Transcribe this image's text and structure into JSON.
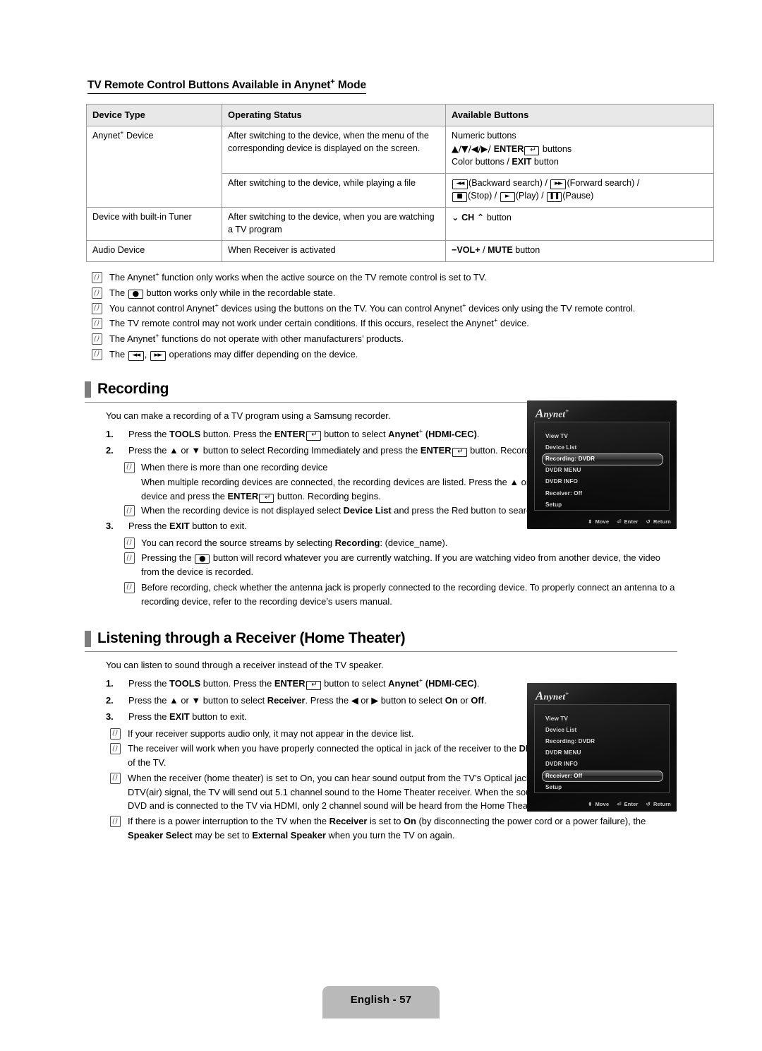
{
  "document": {
    "subtitle_pre": "TV Remote Control Buttons Available in Anynet",
    "subtitle_post": " Mode",
    "sup_plus": "+"
  },
  "table": {
    "headers": [
      "Device Type",
      "Operating Status",
      "Available Buttons"
    ],
    "rows": [
      {
        "device_type": "Anynet+ Device",
        "device_type_pre": "Anynet",
        "device_type_post": " Device",
        "status": "After switching to the device, when the menu of the corresponding device is displayed on the screen.",
        "buttons_line1": "Numeric buttons",
        "buttons_line2_arrows": "▲/▼/◀/▶/ ",
        "buttons_line2_enter": "ENTER",
        "buttons_line2_tail": " buttons",
        "buttons_line3_pre": "Color buttons / ",
        "buttons_line3_exit": "EXIT",
        "buttons_line3_post": " button"
      },
      {
        "status": "After switching to the device, while playing a file",
        "buttons_backward": "(Backward search) / ",
        "buttons_forward": "(Forward search) / ",
        "buttons_stop": "(Stop) / ",
        "buttons_play": "(Play) / ",
        "buttons_pause": "(Pause)"
      },
      {
        "device_type": "Device with built-in Tuner",
        "status": "After switching to the device, when you are watching a TV program",
        "buttons_ch": "CH",
        "buttons_ch_tail": " button"
      },
      {
        "device_type": "Audio Device",
        "status": "When Receiver is activated",
        "buttons_vol": "VOL",
        "buttons_mute": "MUTE",
        "buttons_vol_tail": " button"
      }
    ]
  },
  "top_notes": [
    {
      "parts": [
        {
          "t": "The Anynet"
        },
        {
          "t": "+",
          "sup": true
        },
        {
          "t": " function only works when the active source on the TV remote control is set to TV."
        }
      ]
    },
    {
      "parts": [
        {
          "t": "The "
        },
        {
          "key": "rec"
        },
        {
          "t": " button works only while in the recordable state."
        }
      ]
    },
    {
      "parts": [
        {
          "t": "You cannot control Anynet"
        },
        {
          "t": "+",
          "sup": true
        },
        {
          "t": " devices using the buttons on the TV. You can control Anynet"
        },
        {
          "t": "+",
          "sup": true
        },
        {
          "t": " devices only using the TV remote control."
        }
      ]
    },
    {
      "parts": [
        {
          "t": "The TV remote control may not work under certain conditions. If this occurs, reselect the Anynet"
        },
        {
          "t": "+",
          "sup": true
        },
        {
          "t": " device."
        }
      ]
    },
    {
      "parts": [
        {
          "t": "The Anynet"
        },
        {
          "t": "+",
          "sup": true
        },
        {
          "t": " functions do not operate with other manufacturers’ products."
        }
      ]
    },
    {
      "parts": [
        {
          "t": "The "
        },
        {
          "key": "rew"
        },
        {
          "t": ", "
        },
        {
          "key": "ffw"
        },
        {
          "t": " operations may differ depending on the device."
        }
      ]
    }
  ],
  "recording": {
    "heading": "Recording",
    "intro": "You can make a recording of a TV program using a Samsung recorder.",
    "steps": [
      {
        "num": "1.",
        "parts": [
          {
            "t": "Press the "
          },
          {
            "t": "TOOLS",
            "b": true
          },
          {
            "t": " button. Press the "
          },
          {
            "t": "ENTER",
            "b": true
          },
          {
            "key": "enter"
          },
          {
            "t": " button to select "
          },
          {
            "t": "Anynet",
            "b": true
          },
          {
            "t": "+",
            "sup": true,
            "b": true
          },
          {
            "t": " (HDMI-CEC)",
            "b": true
          },
          {
            "t": "."
          }
        ]
      },
      {
        "num": "2.",
        "parts": [
          {
            "t": "Press the ▲ or ▼ button to select Recording Immediately and press the "
          },
          {
            "t": "ENTER",
            "b": true
          },
          {
            "key": "enter"
          },
          {
            "t": " button. Recording begins."
          }
        ]
      },
      {
        "num": "3.",
        "parts": [
          {
            "t": "Press the "
          },
          {
            "t": "EXIT",
            "b": true
          },
          {
            "t": " button to exit."
          }
        ]
      }
    ],
    "sub_notes": [
      {
        "parts": [
          {
            "t": "When there is more than one recording device"
          }
        ]
      },
      {
        "parts": [
          {
            "t": "When the recording device is not displayed select "
          },
          {
            "t": "Device List",
            "b": true
          },
          {
            "t": " and press the Red button to search devices"
          }
        ]
      }
    ],
    "sub_paragraph": {
      "parts": [
        {
          "t": "When multiple recording devices are connected, the recording devices are listed. Press the ▲ or ▼ button to select a recording device and press the "
        },
        {
          "t": "ENTER",
          "b": true
        },
        {
          "key": "enter"
        },
        {
          "t": " button. Recording begins."
        }
      ]
    },
    "end_notes": [
      {
        "parts": [
          {
            "t": "You can record the source streams by selecting "
          },
          {
            "t": "Recording",
            "b": true
          },
          {
            "t": ": (device_name)."
          }
        ]
      },
      {
        "parts": [
          {
            "t": "Pressing the "
          },
          {
            "key": "rec"
          },
          {
            "t": " button will record whatever you are currently watching. If you are watching video from another device, the video from the device is recorded."
          }
        ]
      },
      {
        "parts": [
          {
            "t": "Before recording, check whether the antenna jack is properly connected to the recording device. To properly connect an antenna to a recording device, refer to the recording device’s users manual."
          }
        ]
      }
    ]
  },
  "receiver": {
    "heading": "Listening through a Receiver (Home Theater)",
    "intro": "You can listen to sound through a receiver instead of the TV speaker.",
    "steps": [
      {
        "num": "1.",
        "parts": [
          {
            "t": "Press the "
          },
          {
            "t": "TOOLS",
            "b": true
          },
          {
            "t": " button. Press the "
          },
          {
            "t": "ENTER",
            "b": true
          },
          {
            "key": "enter"
          },
          {
            "t": " button to select "
          },
          {
            "t": "Anynet",
            "b": true
          },
          {
            "t": "+",
            "sup": true,
            "b": true
          },
          {
            "t": " (HDMI-CEC)",
            "b": true
          },
          {
            "t": "."
          }
        ]
      },
      {
        "num": "2.",
        "parts": [
          {
            "t": "Press the ▲ or ▼ button to select "
          },
          {
            "t": "Receiver",
            "b": true
          },
          {
            "t": ". Press the ◀ or ▶ button to select "
          },
          {
            "t": "On",
            "b": true
          },
          {
            "t": " or "
          },
          {
            "t": "Off",
            "b": true
          },
          {
            "t": "."
          }
        ]
      },
      {
        "num": "3.",
        "parts": [
          {
            "t": "Press the "
          },
          {
            "t": "EXIT",
            "b": true
          },
          {
            "t": " button to exit."
          }
        ]
      }
    ],
    "notes": [
      {
        "parts": [
          {
            "t": "If your receiver supports audio only, it may not appear in the device list."
          }
        ]
      },
      {
        "parts": [
          {
            "t": "The receiver will work when you have properly connected the optical in jack of the receiver to the "
          },
          {
            "t": "DIGITAL AUDIO OUT (OPTICAL)",
            "b": true
          },
          {
            "t": " jack of the TV."
          }
        ]
      },
      {
        "parts": [
          {
            "t": "When the receiver (home theater) is set to On, you can hear sound output from the TV’s Optical jack. When the TV is displaying a DTV(air) signal, the TV will send out 5.1 channel sound to the Home Theater receiver. When the source is a digital component such as a DVD and is connected to the TV via HDMI, only 2 channel sound will be heard from the Home Theater receiver."
          }
        ]
      },
      {
        "parts": [
          {
            "t": "If there is a power interruption to the TV when the "
          },
          {
            "t": "Receiver",
            "b": true
          },
          {
            "t": " is set to "
          },
          {
            "t": "On",
            "b": true
          },
          {
            "t": " (by disconnecting the power cord or a power failure), the "
          },
          {
            "t": "Speaker Select",
            "b": true
          },
          {
            "t": " may be set to "
          },
          {
            "t": "External Speaker",
            "b": true
          },
          {
            "t": " when you turn the TV on again."
          }
        ]
      }
    ]
  },
  "tv_screens": [
    {
      "brand": "Anynet",
      "brand_sup": "+",
      "items": [
        "View TV",
        "Device List",
        "Recording: DVDR",
        "DVDR MENU",
        "DVDR INFO",
        "Receiver: Off",
        "Setup"
      ],
      "selected_index": 2,
      "footer": [
        {
          "glyph": "⬍",
          "label": "Move"
        },
        {
          "glyph": "⏎",
          "label": "Enter"
        },
        {
          "glyph": "↺",
          "label": "Return"
        }
      ]
    },
    {
      "brand": "Anynet",
      "brand_sup": "+",
      "items": [
        "View TV",
        "Device List",
        "Recording: DVDR",
        "DVDR MENU",
        "DVDR INFO",
        "Receiver: Off",
        "Setup"
      ],
      "selected_index": 5,
      "footer": [
        {
          "glyph": "⬍",
          "label": "Move"
        },
        {
          "glyph": "⏎",
          "label": "Enter"
        },
        {
          "glyph": "↺",
          "label": "Return"
        }
      ]
    }
  ],
  "footer": {
    "page_label": "English - 57"
  },
  "colors": {
    "table_header_bg": "#e8e8e8",
    "table_border": "#9a9a9a",
    "heading_bar": "#7d7d7d",
    "footer_badge": "#b9b9b9",
    "tv_bg": "#101010"
  }
}
